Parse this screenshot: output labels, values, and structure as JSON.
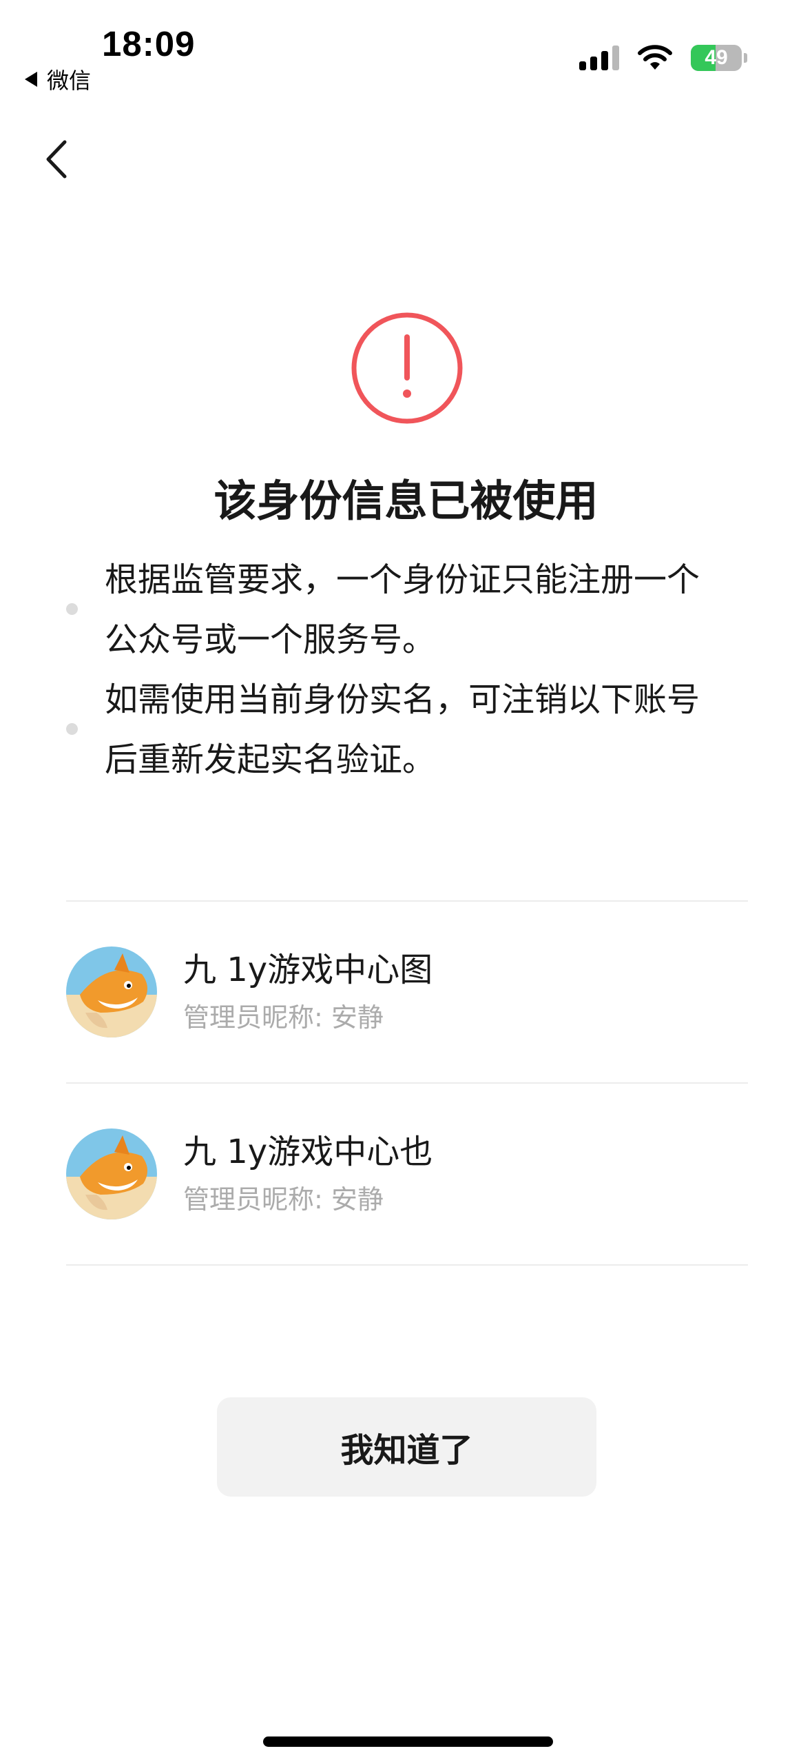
{
  "status_bar": {
    "time": "18:09",
    "back_app": "微信",
    "battery_level": "49",
    "battery_fraction": 0.49
  },
  "nav": {
    "back_icon": "chevron-left-icon"
  },
  "warning": {
    "icon": "exclamation-circle-icon",
    "color": "#f0555a"
  },
  "title": "该身份信息已被使用",
  "description": [
    "根据监管要求，一个身份证只能注册一个公众号或一个服务号。",
    "如需使用当前身份实名，可注销以下账号后重新发起实名验证。"
  ],
  "accounts": [
    {
      "name": "九 1y游戏中心图",
      "admin": "管理员昵称: 安静",
      "avatar": "shark-cartoon-avatar"
    },
    {
      "name": "九 1y游戏中心也",
      "admin": "管理员昵称: 安静",
      "avatar": "shark-cartoon-avatar"
    }
  ],
  "button": {
    "label": "我知道了"
  }
}
